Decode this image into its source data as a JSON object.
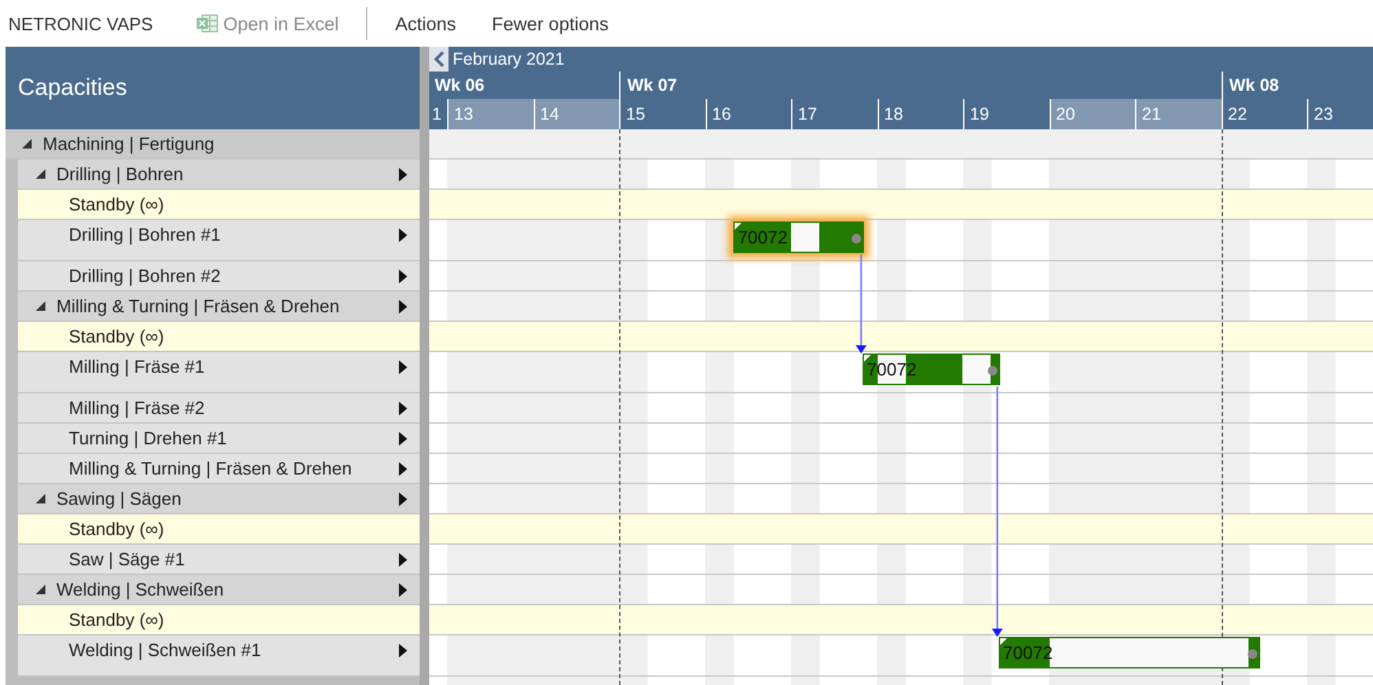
{
  "toolbar": {
    "app_name": "NETRONIC VAPS",
    "items": [
      {
        "label": "Open in Excel",
        "kind": "excel",
        "disabled": true
      },
      {
        "label": "Actions",
        "kind": "plain",
        "disabled": false
      },
      {
        "label": "Fewer options",
        "kind": "plain",
        "disabled": false
      }
    ]
  },
  "panel_title": "Capacities",
  "timeline": {
    "month": "February 2021",
    "weeks": [
      {
        "label": "Wk 06",
        "days": [
          {
            "label": "1",
            "weekend": false
          },
          {
            "label": "13",
            "weekend": true
          },
          {
            "label": "14",
            "weekend": true
          }
        ]
      },
      {
        "label": "Wk 07",
        "days": [
          {
            "label": "15",
            "weekend": false
          },
          {
            "label": "16",
            "weekend": false
          },
          {
            "label": "17",
            "weekend": false
          },
          {
            "label": "18",
            "weekend": false
          },
          {
            "label": "19",
            "weekend": false
          },
          {
            "label": "20",
            "weekend": true
          },
          {
            "label": "21",
            "weekend": true
          }
        ]
      },
      {
        "label": "Wk 08",
        "days": [
          {
            "label": "22",
            "weekend": false
          },
          {
            "label": "23",
            "weekend": false
          }
        ]
      }
    ]
  },
  "resources": [
    {
      "label": "Machining | Fertigung",
      "kind": "group",
      "expanded": true,
      "menu": false,
      "children": [
        {
          "label": "Drilling | Bohren",
          "kind": "group",
          "expanded": true,
          "menu": true,
          "children": [
            {
              "label": "Standby (∞)",
              "kind": "standby",
              "menu": false
            },
            {
              "label": "Drilling | Bohren #1",
              "kind": "resource",
              "menu": true,
              "bars": [
                {
                  "label": "70072",
                  "selected": true,
                  "linked_to_next": true
                }
              ]
            },
            {
              "label": "Drilling | Bohren #2",
              "kind": "resource",
              "menu": true
            }
          ]
        },
        {
          "label": "Milling & Turning | Fräsen & Drehen",
          "kind": "group",
          "expanded": true,
          "menu": true,
          "children": [
            {
              "label": "Standby (∞)",
              "kind": "standby",
              "menu": false
            },
            {
              "label": "Milling | Fräse #1",
              "kind": "resource",
              "menu": true,
              "bars": [
                {
                  "label": "70072",
                  "selected": false,
                  "linked_to_next": true
                }
              ]
            },
            {
              "label": "Milling | Fräse #2",
              "kind": "resource",
              "menu": true
            },
            {
              "label": "Turning | Drehen #1",
              "kind": "resource",
              "menu": true
            },
            {
              "label": "Milling & Turning | Fräsen & Drehen",
              "kind": "resource",
              "menu": true
            }
          ]
        },
        {
          "label": "Sawing | Sägen",
          "kind": "group",
          "expanded": true,
          "menu": true,
          "children": [
            {
              "label": "Standby (∞)",
              "kind": "standby",
              "menu": false
            },
            {
              "label": "Saw | Säge #1",
              "kind": "resource",
              "menu": true
            }
          ]
        },
        {
          "label": "Welding | Schweißen",
          "kind": "group",
          "expanded": true,
          "menu": true,
          "children": [
            {
              "label": "Standby (∞)",
              "kind": "standby",
              "menu": false
            },
            {
              "label": "Welding | Schweißen #1",
              "kind": "resource",
              "menu": true,
              "bars": [
                {
                  "label": "70072",
                  "selected": false,
                  "linked_to_next": false
                }
              ]
            }
          ]
        }
      ]
    }
  ]
}
